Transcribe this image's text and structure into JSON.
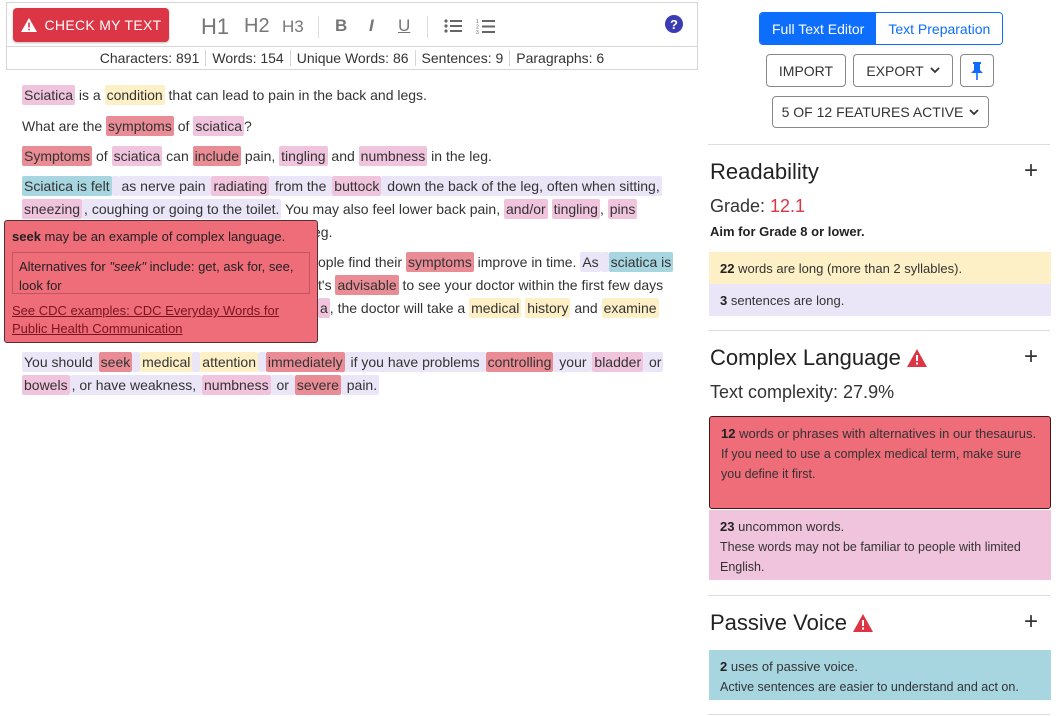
{
  "toolbar": {
    "check_label": "CHECK MY TEXT",
    "h1": "H1",
    "h2": "H2",
    "h3": "H3",
    "bold": "B",
    "italic": "I",
    "underline": "U",
    "help": "?"
  },
  "stats": {
    "characters": "Characters: 891",
    "words": "Words: 154",
    "unique": "Unique Words: 86",
    "sentences": "Sentences: 9",
    "paragraphs": "Paragraphs: 6"
  },
  "doc": {
    "p1": [
      [
        "Sciatica",
        "pink"
      ],
      [
        " is a ",
        ""
      ],
      [
        "condition",
        "yellow"
      ],
      [
        " that can lead to pain in the back and legs.",
        ""
      ]
    ],
    "p2": [
      [
        "What are the ",
        ""
      ],
      [
        "symptoms",
        "red"
      ],
      [
        " of ",
        ""
      ],
      [
        "sciatica",
        "pink"
      ],
      [
        "?",
        ""
      ]
    ],
    "p3": [
      [
        "Symptoms",
        "red"
      ],
      [
        " of ",
        ""
      ],
      [
        "sciatica",
        "pink"
      ],
      [
        " can ",
        ""
      ],
      [
        "include",
        "red"
      ],
      [
        " pain, ",
        ""
      ],
      [
        "tingling",
        "pink"
      ],
      [
        " and ",
        ""
      ],
      [
        "numbness",
        "pink"
      ],
      [
        " in the leg.",
        ""
      ]
    ],
    "p4a": [
      [
        "Sciatica is felt",
        "teal"
      ],
      [
        " ",
        "lav"
      ],
      [
        "as nerve pain ",
        "lav"
      ],
      [
        "radiating",
        "pink"
      ],
      [
        " from the ",
        "lav"
      ],
      [
        "buttock",
        "pink"
      ],
      [
        " down the back of the leg, often when sitting,",
        "lav"
      ]
    ],
    "p4b": [
      [
        "sneezing",
        "pink"
      ],
      [
        ", coughing or going to the toilet.",
        "lav"
      ],
      [
        " You may also feel lower back pain, ",
        ""
      ],
      [
        "and/or",
        "pink"
      ],
      [
        " ",
        ""
      ],
      [
        "tingling",
        "pink"
      ],
      [
        ", ",
        ""
      ],
      [
        "pins",
        "pink"
      ]
    ],
    "p4c": [
      [
        "eg.",
        ""
      ]
    ],
    "p5a": [
      [
        "ople find their ",
        ""
      ],
      [
        "symptoms",
        "red"
      ],
      [
        " improve in time. ",
        ""
      ],
      [
        "As",
        "lav"
      ],
      [
        " ",
        "lav"
      ],
      [
        "sciatica is",
        "teal"
      ]
    ],
    "p5b": [
      [
        "t's ",
        ""
      ],
      [
        "advisable",
        "red"
      ],
      [
        " to see your doctor within the first few days",
        ""
      ]
    ],
    "p5c": [
      [
        "a",
        "pink"
      ],
      [
        ", the doctor will take a ",
        ""
      ],
      [
        "medical",
        "yellow"
      ],
      [
        " ",
        ""
      ],
      [
        "history",
        "yellow"
      ],
      [
        " and ",
        ""
      ],
      [
        "examine",
        "yellow"
      ]
    ],
    "p6a": [
      [
        "You should ",
        "lav"
      ],
      [
        "seek",
        "red"
      ],
      [
        " ",
        "lav"
      ],
      [
        "medical",
        "yellow"
      ],
      [
        " ",
        "lav"
      ],
      [
        "attention",
        "yellow"
      ],
      [
        " ",
        "lav"
      ],
      [
        "immediately",
        "red"
      ],
      [
        " if you have problems ",
        "lav"
      ],
      [
        "controlling",
        "red"
      ],
      [
        " your ",
        "lav"
      ],
      [
        "bladder",
        "pink"
      ],
      [
        " or",
        "lav"
      ]
    ],
    "p6b": [
      [
        "bowels",
        "pink"
      ],
      [
        ", or have weakness, ",
        "lav"
      ],
      [
        "numbness",
        "pink"
      ],
      [
        " or ",
        "lav"
      ],
      [
        "severe",
        "red"
      ],
      [
        " pain.",
        "lav"
      ]
    ]
  },
  "tooltip": {
    "word": "seek",
    "headline_rest": " may be an example of complex language.",
    "alt_prefix": "Alternatives for ",
    "alt_word": "\"seek\"",
    "alt_rest": " include: get, ask for, see, look for",
    "link": "See CDC examples: CDC Everyday Words for Public Health Communication"
  },
  "panel": {
    "mode_full": "Full Text Editor",
    "mode_prep": "Text Preparation",
    "import": "IMPORT",
    "export": "EXPORT",
    "features": "5 OF 12 FEATURES ACTIVE",
    "readability": {
      "title": "Readability",
      "grade_label": "Grade: ",
      "grade_value": "12.1",
      "aim": "Aim for Grade 8 or lower.",
      "long_words_count": "22",
      "long_words_text": " words are long (more than 2 syllables).",
      "long_sent_count": "3",
      "long_sent_text": " sentences are long."
    },
    "complex": {
      "title": "Complex Language",
      "complexity": "Text complexity: 27.9%",
      "alt_count": "12",
      "alt_text": " words or phrases with alternatives in our thesaurus.",
      "alt_sub": "If you need to use a complex medical term, make sure you define it first.",
      "uncommon_count": "23",
      "uncommon_text": " uncommon words.",
      "uncommon_sub": "These words may not be familiar to people with limited English."
    },
    "passive": {
      "title": "Passive Voice",
      "count": "2",
      "text": " uses of passive voice.",
      "sub": "Active sentences are easier to understand and act on."
    },
    "plus": "+"
  },
  "colors": {
    "accent": "#0d6efd",
    "danger": "#dc3545"
  }
}
